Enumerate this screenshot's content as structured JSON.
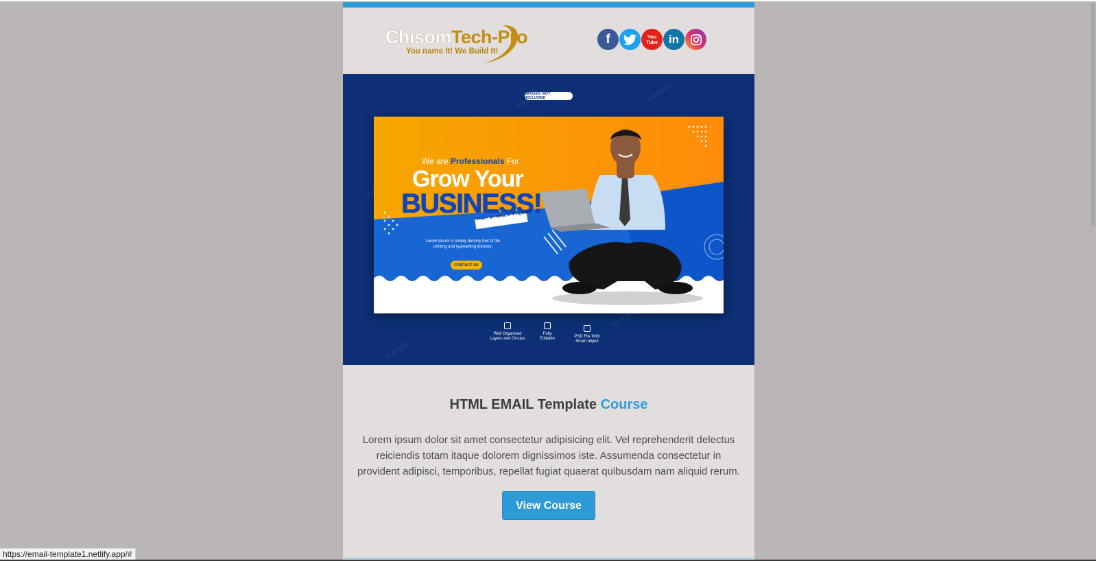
{
  "page": {
    "background_color": "#b9b6b5",
    "email_background": "#e2dedd",
    "accent_color": "#2d9bd6"
  },
  "header": {
    "logo": {
      "name_part1": "Chisom",
      "name_part2": "Tech-Pro",
      "tagline": "You name It! We Build It!"
    },
    "socials": [
      {
        "name": "facebook",
        "glyph": "f",
        "color": "#3b5998"
      },
      {
        "name": "twitter",
        "glyph": "🐦",
        "color": "#1da1f2"
      },
      {
        "name": "youtube",
        "glyph": "You Tube",
        "color": "#e62117"
      },
      {
        "name": "linkedin",
        "glyph": "in",
        "color": "#0e76a8"
      },
      {
        "name": "instagram",
        "glyph": "◎",
        "color": "#c13584"
      }
    ]
  },
  "banner": {
    "pill": "IMAGES NOT INCLUDED",
    "card": {
      "line1_a": "We are",
      "line1_b": "Professionals",
      "line1_c": "For",
      "line2": "Grow Your",
      "line3": "BUSINESS!",
      "tag_a": "Have an",
      "tag_b": "Idea",
      "tag_c": "or",
      "tag_d": "Project?",
      "blurb_1": "Lorem Ipsum is simply dummy text of the",
      "blurb_2": "printing and typesetting industry.",
      "button": "CONTACT US"
    },
    "features": [
      {
        "line1": "Well Organized",
        "line2": "Layers and Groups"
      },
      {
        "line1": "Fully",
        "line2": "Editable"
      },
      {
        "line1": "PSD File With",
        "line2": "Smart object"
      }
    ],
    "watermark": "freepik"
  },
  "content": {
    "headline_part1": "HTML EMAIL Template",
    "headline_part2": "Course",
    "body": "Lorem ipsum dolor sit amet consectetur adipisicing elit. Vel reprehenderit delectus reiciendis totam itaque dolorem dignissimos iste. Assumenda consectetur in provident adipisci, temporibus, repellat fugiat quaerat quibusdam nam aliquid rerum.",
    "cta_label": "View Course"
  },
  "status_bar": {
    "url": "https://email-template1.netlify.app/#"
  }
}
